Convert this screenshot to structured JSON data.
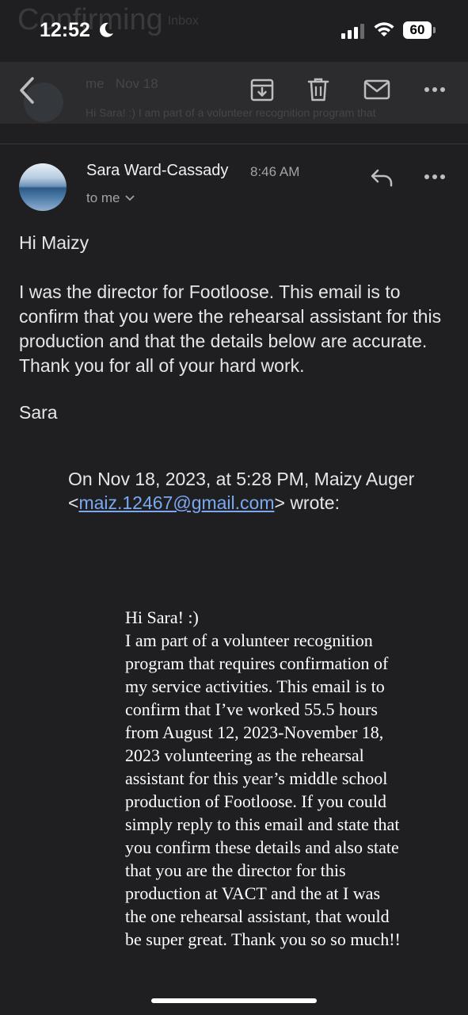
{
  "status_bar": {
    "time": "12:52",
    "battery": "60",
    "behind_overlay_subject": "Confirming",
    "behind_overlay_tag": "Inbox"
  },
  "toolbar": {
    "behind_sender": "me",
    "behind_date": "Nov 18",
    "behind_preview": "Hi Sara! :) I am part of a volunteer recognition program that"
  },
  "message": {
    "sender": "Sara Ward-Cassady",
    "time": "8:46 AM",
    "to": "to me",
    "greeting": "Hi Maizy",
    "paragraph": "I was the director for Footloose. This email is to confirm that you were the rehearsal assistant for this production and that the details below are accurate. Thank you for all of your hard work.",
    "signature": "Sara"
  },
  "quote": {
    "intro": "On Nov 18, 2023, at 5:28 PM, Maizy Auger <",
    "email": "maiz.12467@gmail.com",
    "outro": "> wrote:",
    "greeting": "Hi Sara! :)",
    "body": "I am part of a volunteer recognition program that requires confirmation of my service activities. This email is to confirm that I’ve worked 55.5 hours from August 12, 2023-November 18, 2023 volunteering as the rehearsal assistant for this year’s middle school production of Footloose. If you could simply reply to this email and state that you confirm these details and also state that you are the director for this production at VACT and the at I was the one rehearsal assistant, that would be super great. Thank you so so much!!"
  },
  "colors": {
    "background": "#1f1f21",
    "toolbar": "#2c2c2e",
    "link": "#7aa9f0"
  },
  "icons": [
    "moon-icon",
    "wifi-icon",
    "back-arrow-icon",
    "archive-icon",
    "trash-icon",
    "mail-icon",
    "more-icon",
    "reply-icon",
    "chevron-down-icon"
  ]
}
